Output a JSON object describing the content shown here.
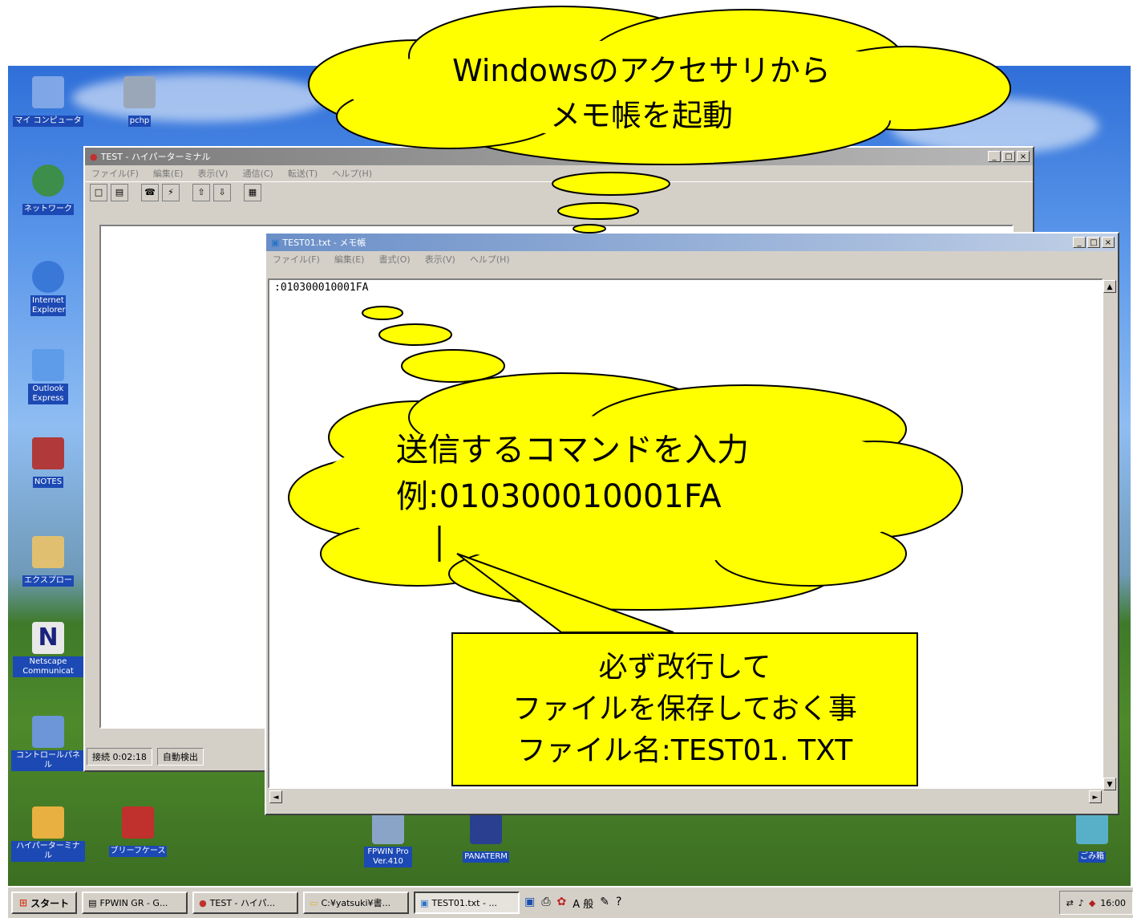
{
  "colors": {
    "bubble": "#ffff00",
    "titlebar_active": "#0a246a",
    "titlebar_inactive": "#808080",
    "desktop_sky": "#5b97ea",
    "desktop_grass": "#4e8a2b"
  },
  "desktop_icons": [
    {
      "label": "マイ コンピュータ",
      "icon": "computer-icon"
    },
    {
      "label": "pchp",
      "icon": "network-computer-icon"
    },
    {
      "label": "ネットワーク",
      "icon": "globe-icon"
    },
    {
      "label": "Internet Explorer",
      "icon": "internet-explorer-icon"
    },
    {
      "label": "Outlook Express",
      "icon": "outlook-express-icon"
    },
    {
      "label": "NOTES",
      "icon": "notes-icon"
    },
    {
      "label": "エクスプロー",
      "icon": "explorer-icon"
    },
    {
      "label": "Netscape Communicat",
      "icon": "netscape-icon"
    },
    {
      "label": "コントロールパネル",
      "icon": "control-panel-icon"
    },
    {
      "label": "ハイパーターミナル",
      "icon": "hyperterminal-icon"
    },
    {
      "label": "ブリーフケース",
      "icon": "briefcase-icon"
    },
    {
      "label": "FPWIN Pro Ver.410",
      "icon": "fpwin-icon"
    },
    {
      "label": "PANATERM",
      "icon": "panaterm-icon"
    },
    {
      "label": "ごみ箱",
      "icon": "recycle-bin-icon"
    }
  ],
  "hyperterminal": {
    "title": "TEST - ハイパーターミナル",
    "menu": [
      "ファイル(F)",
      "編集(E)",
      "表示(V)",
      "通信(C)",
      "転送(T)",
      "ヘルプ(H)"
    ],
    "status_connect": "接続 0:02:18",
    "status_detect": "自動検出",
    "controls": {
      "minimize": "_",
      "maximize": "□",
      "close": "×"
    }
  },
  "notepad": {
    "title": "TEST01.txt - メモ帳",
    "menu": [
      "ファイル(F)",
      "編集(E)",
      "書式(O)",
      "表示(V)",
      "ヘルプ(H)"
    ],
    "content": ":010300010001FA",
    "controls": {
      "minimize": "_",
      "maximize": "□",
      "close": "×"
    }
  },
  "bubbles": {
    "top_line1": "Windowsのアクセサリから",
    "top_line2": "メモ帳を起動",
    "middle_line1": "送信するコマンドを入力",
    "middle_line2": "例:010300010001FA",
    "callout_line1": "必ず改行して",
    "callout_line2": "ファイルを保存しておく事",
    "callout_line3": "ファイル名:TEST01. TXT"
  },
  "taskbar": {
    "start": "スタート",
    "tasks": [
      "FPWIN GR - G...",
      "TEST - ハイパ...",
      "C:¥yatsuki¥書...",
      "TEST01.txt - ..."
    ],
    "tray_ime": "A 般",
    "clock": "16:00"
  }
}
